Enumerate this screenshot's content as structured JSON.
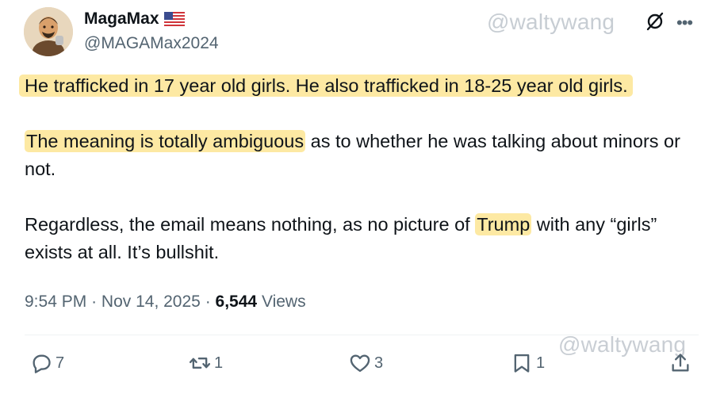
{
  "author": {
    "display_name": "MagaMax",
    "handle": "@MAGAMax2024",
    "flag_icon": "us-flag-icon"
  },
  "watermark": "@waltywang",
  "tweet": {
    "p1_highlight": "He trafficked in 17 year old girls. He also trafficked in 18-25 year old girls.",
    "p2_highlight": "The meaning is totally ambiguous",
    "p2_rest": " as to whether he was talking about minors or not.",
    "p3_pre": "Regardless, the email means nothing, as no picture of ",
    "p3_highlight": "Trump",
    "p3_post": " with any “girls” exists at all. It’s bullshit."
  },
  "meta": {
    "time": "9:54 PM",
    "separator": "·",
    "date": "Nov 14, 2025",
    "views_count": "6,544",
    "views_label": "Views"
  },
  "actions": {
    "replies": "7",
    "reposts": "1",
    "likes": "3",
    "bookmarks": "1"
  },
  "colors": {
    "highlight": "#fde9a3",
    "text": "#0f1419",
    "secondary": "#536471"
  }
}
